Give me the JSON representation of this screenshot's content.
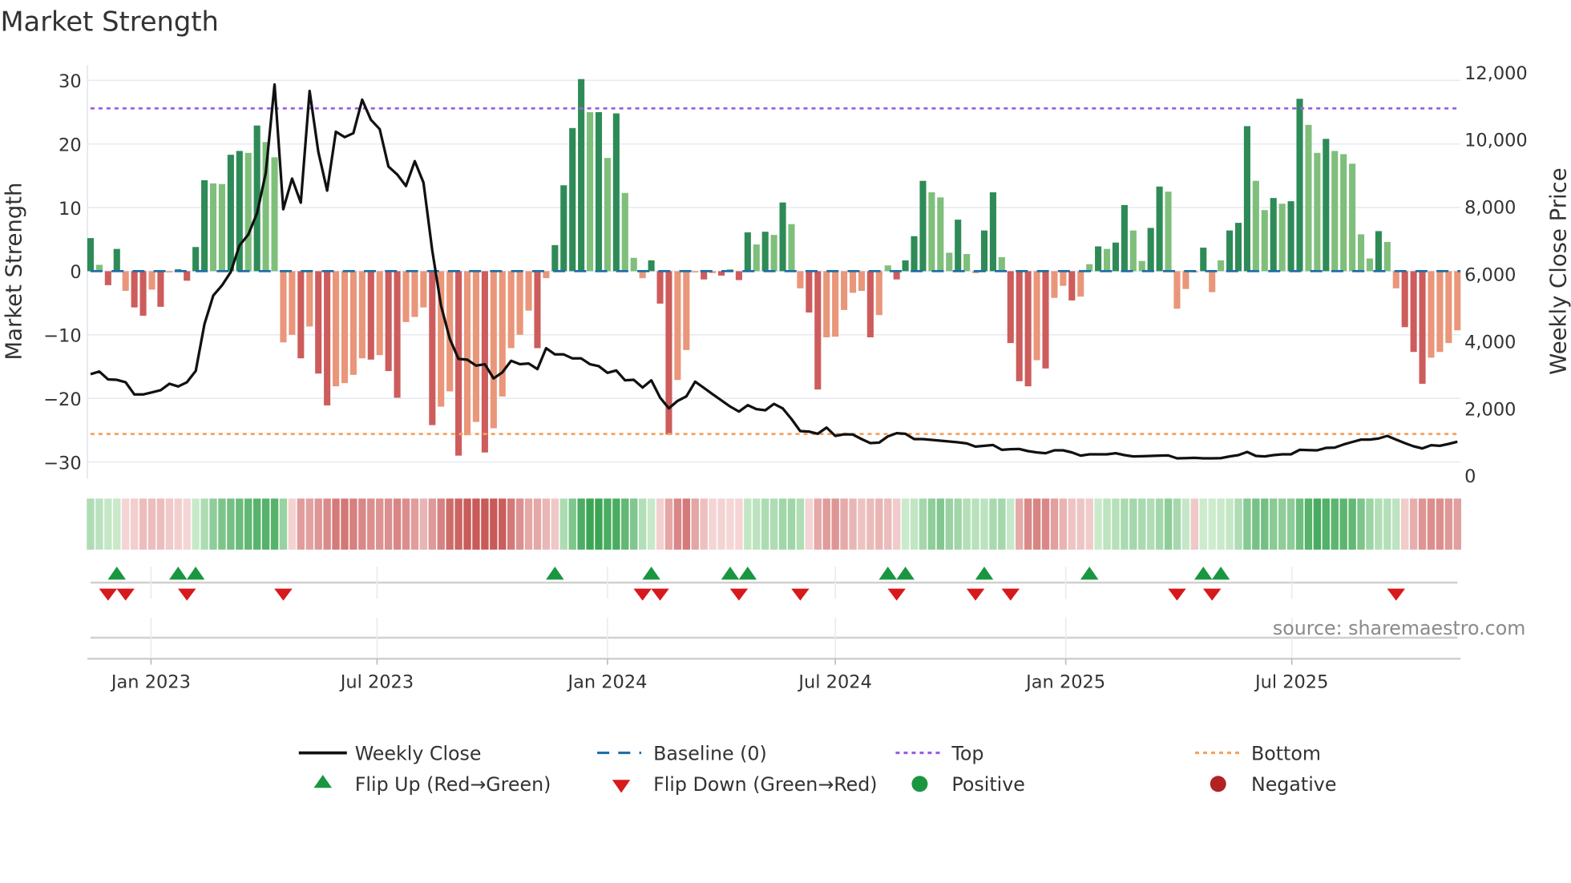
{
  "title": "Market Strength",
  "source": "source: sharemaestro.com",
  "colors": {
    "green_dark": "#2e8b57",
    "green_light": "#7fbf7b",
    "red_dark": "#cd5c5c",
    "red_light": "#e9967a",
    "close_line": "#111111",
    "baseline": "#1f6fa8",
    "top": "#9b5de5",
    "bottom": "#f4a261",
    "flip_up": "#1a9641",
    "flip_down": "#d7191c"
  },
  "legend": {
    "weekly_close": "Weekly Close",
    "baseline": "Baseline (0)",
    "top": "Top",
    "bottom": "Bottom",
    "flip_up": "Flip Up (Red→Green)",
    "flip_down": "Flip Down (Green→Red)",
    "positive": "Positive",
    "negative": "Negative"
  },
  "chart_data": {
    "type": "bar",
    "title": "Market Strength",
    "ylabel": "Market Strength",
    "y2label": "Weekly Close Price",
    "ylim": [
      -32.6,
      32.4
    ],
    "y2lim": [
      -90,
      12210
    ],
    "yticks": [
      30,
      20,
      10,
      0,
      -10,
      -20,
      -30
    ],
    "ytick_labels": [
      "30",
      "20",
      "10",
      "0",
      "−10",
      "−20",
      "−30"
    ],
    "y2ticks": [
      12000,
      10000,
      8000,
      6000,
      4000,
      2000,
      0
    ],
    "y2tick_labels": [
      "12,000",
      "10,000",
      "8,000",
      "6,000",
      "4,000",
      "2,000",
      "0"
    ],
    "xticks": [
      {
        "week": 6.9,
        "label": "Jan 2023"
      },
      {
        "week": 32.7,
        "label": "Jul 2023"
      },
      {
        "week": 59,
        "label": "Jan 2024"
      },
      {
        "week": 85,
        "label": "Jul 2024"
      },
      {
        "week": 111.3,
        "label": "Jan 2025"
      },
      {
        "week": 137.1,
        "label": "Jul 2025"
      }
    ],
    "top_level": 25.6,
    "bottom_level": -25.6,
    "baseline": 0,
    "strength": [
      5.2,
      1,
      -2.2,
      3.5,
      -3.1,
      -5.7,
      -7,
      -2.9,
      -5.6,
      -0.2,
      0.3,
      -1.5,
      3.8,
      14.3,
      13.8,
      13.7,
      18.3,
      18.9,
      18.6,
      22.9,
      20.3,
      17.9,
      -11.2,
      -10,
      -13.7,
      -8.7,
      -16.1,
      -21.1,
      -18.1,
      -17.6,
      -16.3,
      -13.7,
      -13.9,
      -13.2,
      -15.7,
      -19.9,
      -8,
      -7.2,
      -5.7,
      -24.2,
      -21.3,
      -18.9,
      -29,
      -25.8,
      -23.7,
      -28.5,
      -24.7,
      -19.7,
      -12.1,
      -10,
      -6.2,
      -12.1,
      -1.1,
      4.1,
      13.5,
      22.5,
      30.2,
      25,
      25,
      17.8,
      24.8,
      12.3,
      2.1,
      -1.1,
      1.7,
      -5.1,
      -25.7,
      -17.1,
      -12.4,
      -0.2,
      -1.3,
      -0.3,
      -0.7,
      0.3,
      -1.4,
      6.1,
      4.2,
      6.2,
      5.7,
      10.8,
      7.4,
      -2.7,
      -6.5,
      -18.6,
      -10.4,
      -10.3,
      -6.1,
      -3.4,
      -3.1,
      -10.4,
      -6.9,
      0.9,
      -1.3,
      1.7,
      5.5,
      14.2,
      12.4,
      11.6,
      2.9,
      8.1,
      2.7,
      -0.3,
      6.4,
      12.4,
      2.2,
      -11.3,
      -17.3,
      -18.1,
      -14,
      -15.3,
      -4.2,
      -2.3,
      -4.6,
      -4,
      1.1,
      3.9,
      3.5,
      4.5,
      10.4,
      6.4,
      1.6,
      6.8,
      13.3,
      12.5,
      -5.9,
      -2.8,
      -0.2,
      3.7,
      -3.3,
      1.7,
      6.4,
      7.6,
      22.8,
      14.2,
      9.6,
      11.5,
      10.6,
      11,
      27.1,
      23,
      18.6,
      20.8,
      18.9,
      18.4,
      16.9,
      5.8,
      2,
      6.3,
      4.6,
      -2.7,
      -8.8,
      -12.7,
      -17.7,
      -13.6,
      -12.7,
      -11.3,
      -9.3
    ],
    "weekly_close": [
      3015,
      3095,
      2857,
      2848,
      2776,
      2411,
      2411,
      2475,
      2539,
      2729,
      2650,
      2776,
      3111,
      4502,
      5353,
      5655,
      6052,
      6847,
      7165,
      7801,
      8994,
      11633,
      7920,
      8834,
      8119,
      11441,
      9629,
      8476,
      10226,
      10067,
      10186,
      11180,
      10583,
      10305,
      9192,
      8954,
      8612,
      9351,
      8715,
      6688,
      5058,
      4065,
      3468,
      3445,
      3270,
      3310,
      2888,
      3071,
      3413,
      3310,
      3333,
      3166,
      3787,
      3603,
      3603,
      3485,
      3485,
      3310,
      3254,
      3055,
      3127,
      2832,
      2848,
      2618,
      2832,
      2316,
      1998,
      2220,
      2355,
      2792,
      2608,
      2419,
      2235,
      2051,
      1902,
      2093,
      1974,
      1942,
      2133,
      1998,
      1680,
      1322,
      1307,
      1242,
      1426,
      1179,
      1226,
      1219,
      1084,
      964,
      980,
      1163,
      1259,
      1242,
      1084,
      1084,
      1059,
      1036,
      1012,
      989,
      956,
      861,
      885,
      908,
      766,
      782,
      789,
      726,
      686,
      663,
      750,
      750,
      686,
      591,
      631,
      631,
      631,
      663,
      606,
      567,
      574,
      583,
      591,
      599,
      511,
      519,
      527,
      511,
      511,
      519,
      567,
      606,
      703,
      583,
      567,
      606,
      631,
      631,
      766,
      757,
      750,
      821,
      829,
      924,
      996,
      1068,
      1068,
      1100,
      1179,
      1068,
      964,
      869,
      805,
      901,
      885,
      940,
      1005
    ],
    "flip_up_weeks": [
      3,
      10,
      12,
      53,
      64,
      73,
      75,
      91,
      93,
      102,
      114,
      127,
      129
    ],
    "flip_down_weeks": [
      2,
      4,
      11,
      22,
      63,
      65,
      74,
      81,
      92,
      101,
      105,
      124,
      128,
      149
    ]
  }
}
